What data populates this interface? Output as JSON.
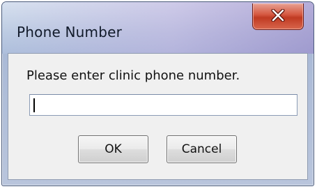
{
  "dialog": {
    "title": "Phone Number",
    "prompt": "Please enter clinic phone number.",
    "input_value": "",
    "ok_label": "OK",
    "cancel_label": "Cancel",
    "close_icon": "close-icon"
  },
  "colors": {
    "close_button": "#c9452e",
    "client_background": "#f0f0f0"
  }
}
